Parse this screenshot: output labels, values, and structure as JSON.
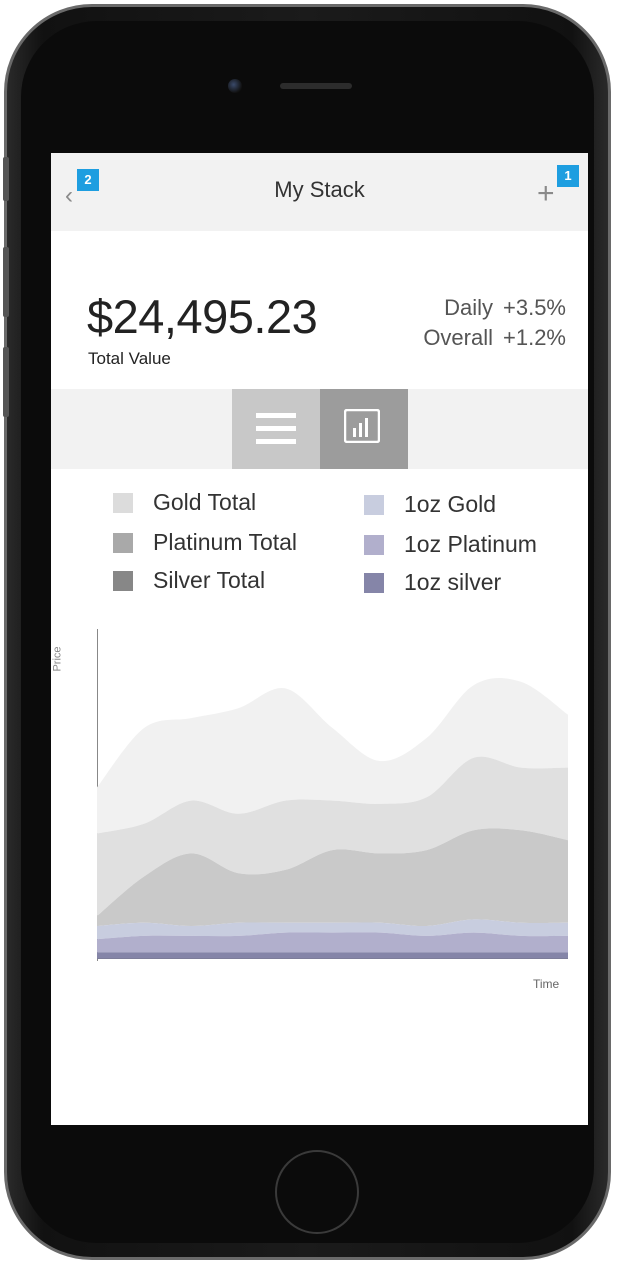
{
  "app": {
    "title": "My Stack"
  },
  "markers": {
    "add": "1",
    "back": "2"
  },
  "nav": {
    "back_icon": "‹",
    "add_icon": "+"
  },
  "summary": {
    "total_value": "$24,495.23",
    "total_label": "Total Value",
    "daily_label": "Daily",
    "daily_value": "+3.5%",
    "overall_label": "Overall",
    "overall_value": "+1.2%"
  },
  "view_toggle": {
    "active": "chart",
    "options": [
      "list-icon",
      "bar-chart-icon"
    ]
  },
  "legend": [
    {
      "label": "Gold Total",
      "color": "#dcdcdc"
    },
    {
      "label": "Platinum Total",
      "color": "#a9a9a9"
    },
    {
      "label": "Silver Total",
      "color": "#878787"
    },
    {
      "label": "1oz Gold",
      "color": "#c8cddf"
    },
    {
      "label": "1oz Platinum",
      "color": "#b1afcc"
    },
    {
      "label": "1oz silver",
      "color": "#8585a8"
    }
  ],
  "chart_data": {
    "type": "area",
    "xlabel": "Time",
    "ylabel": "Price",
    "stacked": true,
    "ylim": [
      0,
      100
    ],
    "grid": false,
    "x": [
      0,
      1,
      2,
      3,
      4,
      5,
      6,
      7,
      8,
      9,
      10
    ],
    "series": [
      {
        "name": "1oz silver",
        "color": "#8585a8",
        "values": [
          2,
          2,
          2,
          2,
          2,
          2,
          2,
          2,
          2,
          2,
          2
        ]
      },
      {
        "name": "1oz Platinum",
        "color": "#b1afcc",
        "values": [
          4,
          5,
          5,
          5,
          6,
          6,
          6,
          5,
          6,
          5,
          5
        ]
      },
      {
        "name": "1oz Gold",
        "color": "#c8cddf",
        "values": [
          4,
          4,
          3,
          4,
          3,
          3,
          3,
          3,
          4,
          4,
          4
        ]
      },
      {
        "name": "Silver Total",
        "color": "#c9c9c9",
        "values": [
          3,
          14,
          22,
          15,
          16,
          22,
          21,
          23,
          27,
          28,
          25
        ]
      },
      {
        "name": "Platinum Total",
        "color": "#e0e0e0",
        "values": [
          25,
          16,
          16,
          18,
          21,
          15,
          15,
          16,
          22,
          19,
          22
        ]
      },
      {
        "name": "Gold Total",
        "color": "#f1f1f1",
        "values": [
          14,
          29,
          25,
          32,
          34,
          22,
          13,
          18,
          22,
          26,
          16
        ]
      }
    ]
  }
}
